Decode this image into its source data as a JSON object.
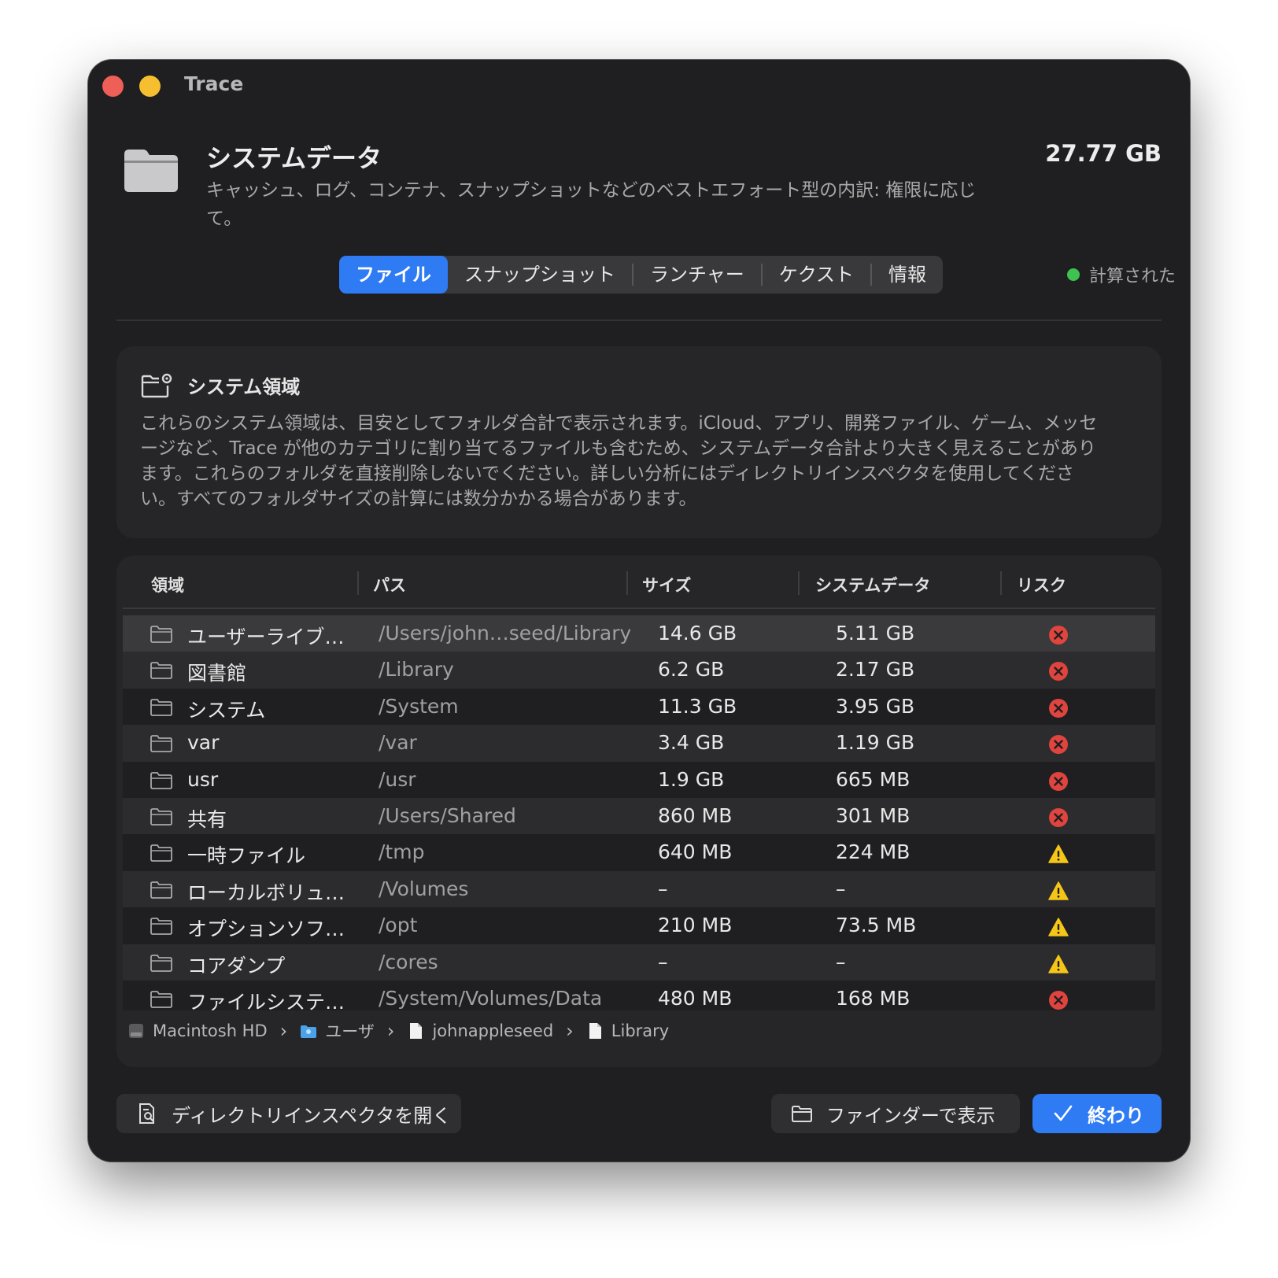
{
  "window": {
    "title": "Trace"
  },
  "header": {
    "title": "システムデータ",
    "subtitle": "キャッシュ、ログ、コンテナ、スナップショットなどのベストエフォート型の内訳: 権限に応じて。",
    "total_size": "27.77 GB",
    "icon": "folder-icon"
  },
  "tabs": [
    {
      "label": "ファイル",
      "active": true
    },
    {
      "label": "スナップショット",
      "active": false
    },
    {
      "label": "ランチャー",
      "active": false
    },
    {
      "label": "ケクスト",
      "active": false
    },
    {
      "label": "情報",
      "active": false
    }
  ],
  "status": {
    "label": "計算された",
    "color": "#3fc350"
  },
  "info_card": {
    "title": "システム領域",
    "icon": "folder-gear-icon",
    "body": "これらのシステム領域は、目安としてフォルダ合計で表示されます。iCloud、アプリ、開発ファイル、ゲーム、メッセージなど、Trace が他のカテゴリに割り当てるファイルも含むため、システムデータ合計より大きく見えることがあります。これらのフォルダを直接削除しないでください。詳しい分析にはディレクトリインスペクタを使用してください。すべてのフォルダサイズの計算には数分かかる場合があります。"
  },
  "table": {
    "columns": [
      "領域",
      "パス",
      "サイズ",
      "システムデータ",
      "リスク"
    ],
    "rows": [
      {
        "name": "ユーザーライブ…",
        "path": "/Users/john…seed/Library",
        "size": "14.6 GB",
        "system": "5.11 GB",
        "risk": "high"
      },
      {
        "name": "図書館",
        "path": "/Library",
        "size": "6.2 GB",
        "system": "2.17 GB",
        "risk": "high"
      },
      {
        "name": "システム",
        "path": "/System",
        "size": "11.3 GB",
        "system": "3.95 GB",
        "risk": "high"
      },
      {
        "name": "var",
        "path": "/var",
        "size": "3.4 GB",
        "system": "1.19 GB",
        "risk": "high"
      },
      {
        "name": "usr",
        "path": "/usr",
        "size": "1.9 GB",
        "system": "665 MB",
        "risk": "high"
      },
      {
        "name": "共有",
        "path": "/Users/Shared",
        "size": "860 MB",
        "system": "301 MB",
        "risk": "high"
      },
      {
        "name": "一時ファイル",
        "path": "/tmp",
        "size": "640 MB",
        "system": "224 MB",
        "risk": "medium"
      },
      {
        "name": "ローカルボリュ…",
        "path": "/Volumes",
        "size": "–",
        "system": "–",
        "risk": "medium"
      },
      {
        "name": "オプションソフ…",
        "path": "/opt",
        "size": "210 MB",
        "system": "73.5 MB",
        "risk": "medium"
      },
      {
        "name": "コアダンプ",
        "path": "/cores",
        "size": "–",
        "system": "–",
        "risk": "medium"
      },
      {
        "name": "ファイルシステ…",
        "path": "/System/Volumes/Data",
        "size": "480 MB",
        "system": "168 MB",
        "risk": "high"
      }
    ],
    "selected_row": 0
  },
  "breadcrumb": [
    {
      "label": "Macintosh HD",
      "icon": "disk-icon"
    },
    {
      "label": "ユーザ",
      "icon": "users-folder-icon"
    },
    {
      "label": "johnappleseed",
      "icon": "document-icon"
    },
    {
      "label": "Library",
      "icon": "document-icon"
    }
  ],
  "buttons": {
    "inspector": "ディレクトリインスペクタを開く",
    "finder": "ファインダーで表示",
    "done": "終わり"
  },
  "colors": {
    "accent": "#2e7bf3",
    "risk_high": "#e0443e",
    "risk_medium": "#f5c518"
  }
}
